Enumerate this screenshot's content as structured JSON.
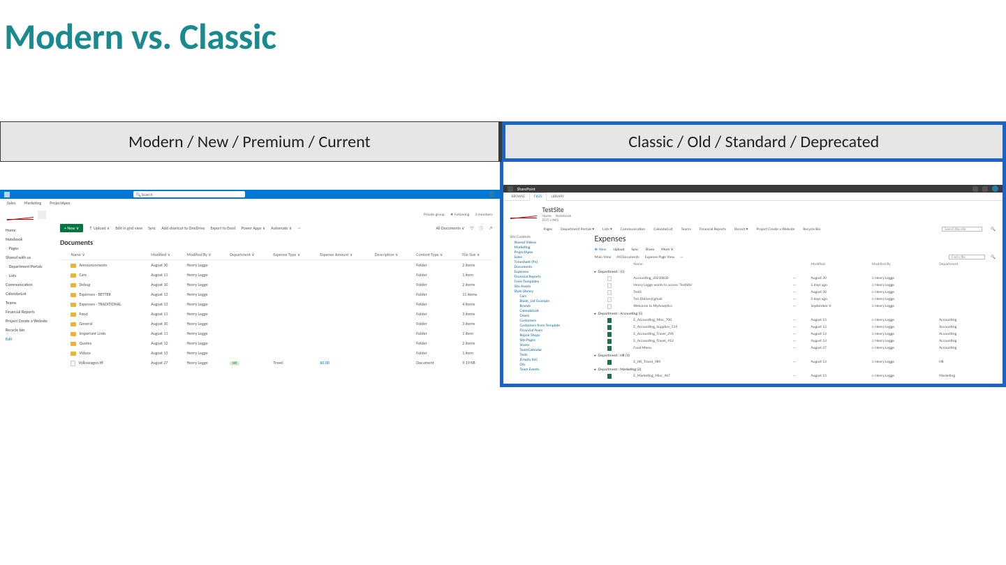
{
  "title": "Modern vs. Classic",
  "headers": {
    "left": "Modern / New / Premium / Current",
    "right": "Classic / Old / Standard / Deprecated"
  },
  "modern": {
    "search_placeholder": "Search",
    "hub_nav": [
      "Sales",
      "Marketing",
      "ProjectApex"
    ],
    "site_meta": {
      "group": "Private group",
      "follow": "★ Following",
      "members": "3 members"
    },
    "left_nav": [
      {
        "label": "Home",
        "cls": ""
      },
      {
        "label": "Notebook",
        "cls": ""
      },
      {
        "label": "Pages",
        "cls": "exp"
      },
      {
        "label": "Shared with us",
        "cls": ""
      },
      {
        "label": "Department Portals",
        "cls": "exp"
      },
      {
        "label": "Lists",
        "cls": "exp"
      },
      {
        "label": "Communication",
        "cls": ""
      },
      {
        "label": "CalendarList",
        "cls": ""
      },
      {
        "label": "Teams",
        "cls": ""
      },
      {
        "label": "Financial Reports",
        "cls": ""
      },
      {
        "label": "Project Create a Website",
        "cls": ""
      },
      {
        "label": "Recycle bin",
        "cls": ""
      },
      {
        "label": "Edit",
        "cls": "edit"
      }
    ],
    "cmd": {
      "new": "+ New ∨",
      "upload": "↑ Upload ∨",
      "grid": "Edit in grid view",
      "sync": "Sync",
      "shortcut": "Add shortcut to OneDrive",
      "excel": "Export to Excel",
      "powerapps": "Power Apps ∨",
      "automate": "Automate ∨",
      "view": "All Documents ∨"
    },
    "lib_title": "Documents",
    "columns": [
      "",
      "Name ∨",
      "Modified ∨",
      "Modified By ∨",
      "Department ∨",
      "Expense Type ∨",
      "Expense Amount ∨",
      "Description ∨",
      "Content Type ∨",
      "File Size ∨"
    ],
    "rows": [
      {
        "ico": "folder",
        "name": "Announcements",
        "mod": "August 30",
        "by": "Henry Legge",
        "ct": "Folder",
        "size": "2 items"
      },
      {
        "ico": "folder",
        "name": "Cars",
        "mod": "August 11",
        "by": "Henry Legge",
        "ct": "Folder",
        "size": "1 item"
      },
      {
        "ico": "folder",
        "name": "Debug",
        "mod": "August 10",
        "by": "Henry Legge",
        "ct": "Folder",
        "size": "2 items"
      },
      {
        "ico": "folder",
        "name": "Expenses - BETTER",
        "mod": "August 13",
        "by": "Henry Legge",
        "ct": "Folder",
        "size": "11 items"
      },
      {
        "ico": "folder",
        "name": "Expenses - TRADITIONAL",
        "mod": "August 13",
        "by": "Henry Legge",
        "ct": "Folder",
        "size": "4 items"
      },
      {
        "ico": "folder",
        "name": "Food",
        "mod": "August 11",
        "by": "Henry Legge",
        "ct": "Folder",
        "size": "3 items"
      },
      {
        "ico": "folder",
        "name": "General",
        "mod": "August 30",
        "by": "Henry Legge",
        "ct": "Folder",
        "size": "3 items"
      },
      {
        "ico": "folder",
        "name": "Important Links",
        "mod": "August 11",
        "by": "Henry Legge",
        "ct": "Folder",
        "size": "1 item"
      },
      {
        "ico": "folder",
        "name": "Quotes",
        "mod": "August 12",
        "by": "Henry Legge",
        "ct": "Folder",
        "size": "2 items"
      },
      {
        "ico": "folder",
        "name": "Videos",
        "mod": "August 13",
        "by": "Henry Legge",
        "ct": "Folder",
        "size": "1 item"
      },
      {
        "ico": "file",
        "name": "Volkswagen.tff",
        "mod": "August 27",
        "by": "Henry Legge",
        "dept": "HR",
        "etype": "Travel",
        "amt": "$0.00",
        "ct": "Document",
        "size": "9.19 KB"
      }
    ]
  },
  "classic": {
    "product": "SharePoint",
    "ribbon": [
      "BROWSE",
      "FILES",
      "LIBRARY"
    ],
    "site_title": "TestSite",
    "site_sub": [
      "Home",
      "Notebook"
    ],
    "edit_links": "EDIT LINKS",
    "topnav": [
      "Pages",
      "Department Portals ▾",
      "Lists ▾",
      "Communication",
      "CalendarList",
      "Teams",
      "Financial Reports",
      "Recent ▾",
      "Project Create a Website",
      "Recycle Bin"
    ],
    "search_placeholder": "Search this site",
    "tree": {
      "hd": "Site Contents",
      "items": [
        {
          "t": "Shared Videos",
          "l": 1
        },
        {
          "t": "Marketing",
          "l": 1
        },
        {
          "t": "ProjectApex",
          "l": 1
        },
        {
          "t": "Sales",
          "l": 1
        },
        {
          "t": "Timesheet (Pn)",
          "l": 1
        },
        {
          "t": "Documents",
          "l": 1
        },
        {
          "t": "Expenses",
          "l": 1
        },
        {
          "t": "Financial Reports",
          "l": 1
        },
        {
          "t": "Form Templates",
          "l": 1
        },
        {
          "t": "Site Assets",
          "l": 1
        },
        {
          "t": "Style Library",
          "l": 1
        },
        {
          "t": "Cars",
          "l": 2
        },
        {
          "t": "Blank_List Example",
          "l": 2
        },
        {
          "t": "Brands",
          "l": 2
        },
        {
          "t": "CalendarList",
          "l": 2
        },
        {
          "t": "Check",
          "l": 2
        },
        {
          "t": "Customers",
          "l": 2
        },
        {
          "t": "Customers from Template",
          "l": 2
        },
        {
          "t": "Financial Years",
          "l": 2
        },
        {
          "t": "Repair Shops",
          "l": 2
        },
        {
          "t": "Site Pages",
          "l": 2
        },
        {
          "t": "Stores",
          "l": 2
        },
        {
          "t": "TeamCalendar",
          "l": 2
        },
        {
          "t": "Tests",
          "l": 2
        },
        {
          "t": "(Empty list)",
          "l": 2
        },
        {
          "t": "CKs",
          "l": 2
        },
        {
          "t": "Team Events",
          "l": 2
        }
      ]
    },
    "lib_title": "Expenses",
    "bar": {
      "new": "New",
      "upload": "Upload",
      "sync": "Sync",
      "share": "Share",
      "more": "More ∨"
    },
    "views": [
      "Main View",
      "All Documents",
      "Expense Page View",
      "···"
    ],
    "find_placeholder": "Find a file",
    "columns": [
      "",
      "",
      "Name",
      "",
      "Modified",
      "Modified By",
      "Department"
    ],
    "groups": [
      {
        "label": "Department : (5)",
        "rows": [
          {
            "ico": "doc",
            "name": "Accounting_20210830",
            "mod": "August 30",
            "by": "Henry Legge",
            "dept": ""
          },
          {
            "ico": "doc",
            "name": "Henry Legge wants to access 'TestSite'",
            "mod": "5 days ago",
            "by": "Henry Legge",
            "dept": ""
          },
          {
            "ico": "doc",
            "name": "Test1",
            "mod": "August 30",
            "by": "Henry Legge",
            "dept": ""
          },
          {
            "ico": "doc",
            "name": "Teri.Didion@gmail",
            "mod": "5 days ago",
            "by": "Henry Legge",
            "dept": ""
          },
          {
            "ico": "doc",
            "name": "Welcome to MyAnalytics",
            "mod": "September 6",
            "by": "Henry Legge",
            "dept": ""
          }
        ]
      },
      {
        "label": "Department : Accounting (5)",
        "rows": [
          {
            "ico": "xls",
            "name": "E_Accounting_Misc_700",
            "mod": "August 13",
            "by": "Henry Legge",
            "dept": "Accounting"
          },
          {
            "ico": "xls",
            "name": "E_Accounting_Supplies_519",
            "mod": "August 13",
            "by": "Henry Legge",
            "dept": "Accounting"
          },
          {
            "ico": "xls",
            "name": "E_Accounting_Travel_296",
            "mod": "August 13",
            "by": "Henry Legge",
            "dept": "Accounting"
          },
          {
            "ico": "xls",
            "name": "E_Accounting_Travel_412",
            "mod": "August 13",
            "by": "Henry Legge",
            "dept": "Accounting"
          },
          {
            "ico": "xls",
            "name": "Food Menu",
            "mod": "August 27",
            "by": "Henry Legge",
            "dept": "Accounting"
          }
        ]
      },
      {
        "label": "Department : HR (1)",
        "rows": [
          {
            "ico": "xls",
            "name": "E_HR_Travel_989",
            "mod": "August 13",
            "by": "Henry Legge",
            "dept": "HR"
          }
        ]
      },
      {
        "label": "Department : Marketing (2)",
        "rows": [
          {
            "ico": "xls",
            "name": "E_Marketing_Misc_467",
            "mod": "August 13",
            "by": "Henry Legge",
            "dept": "Marketing"
          }
        ]
      }
    ]
  }
}
